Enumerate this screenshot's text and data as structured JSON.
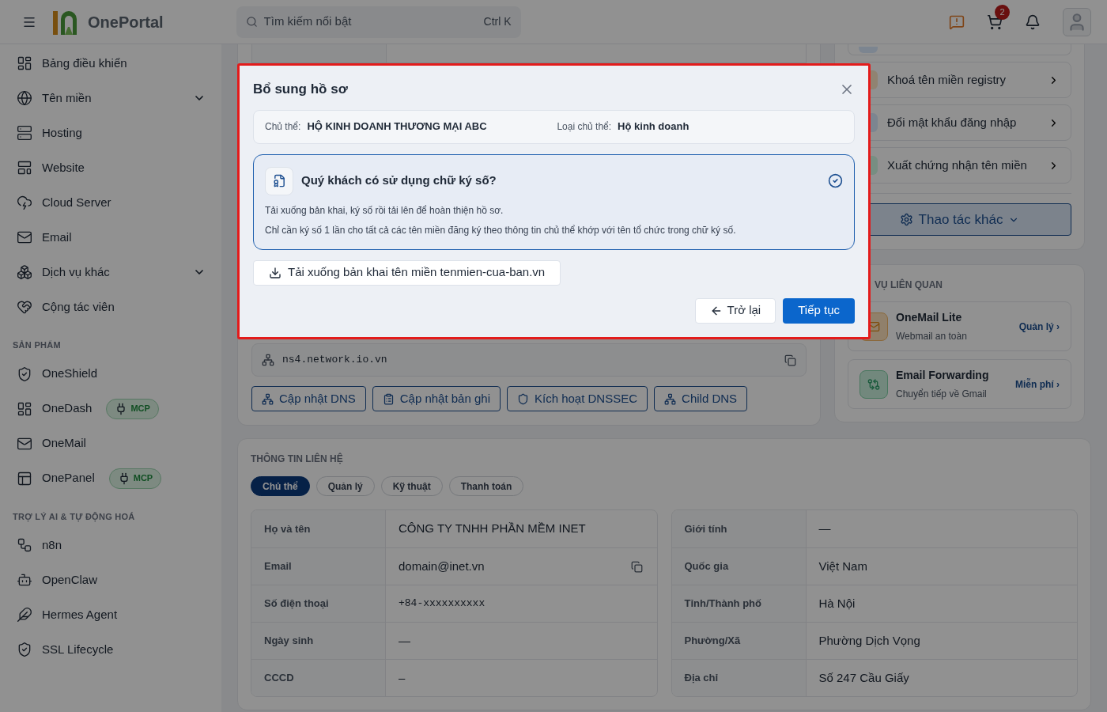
{
  "header": {
    "brand": "OnePortal",
    "search": {
      "placeholder": "Tìm kiếm nổi bật",
      "shortcut": "Ctrl K"
    },
    "cart_badge": "2"
  },
  "sidebar": {
    "sections": [
      {
        "items": [
          {
            "label": "Bảng điều khiển",
            "kind": "link"
          },
          {
            "label": "Tên miền",
            "kind": "group",
            "expanded": false
          },
          {
            "label": "Hosting",
            "kind": "link"
          },
          {
            "label": "Website",
            "kind": "link"
          },
          {
            "label": "Cloud Server",
            "kind": "link"
          },
          {
            "label": "Email",
            "kind": "link"
          },
          {
            "label": "Dịch vụ khác",
            "kind": "group",
            "expanded": false
          },
          {
            "label": "Cộng tác viên",
            "kind": "link"
          }
        ]
      },
      {
        "title": "SẢN PHẨM",
        "items": [
          {
            "label": "OneShield",
            "kind": "link"
          },
          {
            "label": "OneDash",
            "kind": "link",
            "badge": "MCP"
          },
          {
            "label": "OneMail",
            "kind": "link"
          },
          {
            "label": "OnePanel",
            "kind": "link",
            "badge": "MCP"
          }
        ]
      },
      {
        "title": "TRỢ LÝ AI & TỰ ĐỘNG HOÁ",
        "items": [
          {
            "label": "n8n",
            "kind": "link"
          },
          {
            "label": "OpenClaw",
            "kind": "link"
          },
          {
            "label": "Hermes Agent",
            "kind": "link"
          },
          {
            "label": "SSL Lifecycle",
            "kind": "link"
          }
        ]
      }
    ]
  },
  "dns": {
    "nameserver": "ns4.network.io.vn",
    "buttons": [
      "Cập nhật DNS",
      "Cập nhật bản ghi",
      "Kích hoạt DNSSEC",
      "Child DNS"
    ]
  },
  "actions": {
    "items": [
      "Khoá tên miền registry",
      "Đổi mật khẩu đăng nhập",
      "Xuất chứng nhận tên miền"
    ],
    "more": "Thao tác khác"
  },
  "related": {
    "title": "VỤ LIÊN QUAN",
    "services": [
      {
        "name": "OneMail Lite",
        "subtitle": "Webmail an toàn",
        "link": "Quản lý ›"
      },
      {
        "name": "Email Forwarding",
        "subtitle": "Chuyển tiếp về Gmail",
        "link": "Miễn phí ›"
      }
    ]
  },
  "contact": {
    "title": "THÔNG TIN LIÊN HỆ",
    "tabs": [
      {
        "label": "Chủ thể",
        "selected": true
      },
      {
        "label": "Quản lý",
        "selected": false
      },
      {
        "label": "Kỹ thuật",
        "selected": false
      },
      {
        "label": "Thanh toán",
        "selected": false
      }
    ],
    "left_rows": [
      {
        "label": "Họ và tên",
        "value": "CÔNG TY TNHH PHẦN MỀM INET",
        "copyable": false
      },
      {
        "label": "Email",
        "value": "domain@inet.vn",
        "copyable": true
      },
      {
        "label": "Số điện thoại",
        "value": "+84-xxxxxxxxxx",
        "copyable": false
      },
      {
        "label": "Ngày sinh",
        "value": "—",
        "copyable": false
      },
      {
        "label": "CCCD",
        "value": "–",
        "copyable": false
      }
    ],
    "right_rows": [
      {
        "label": "Giới tính",
        "value": "—",
        "copyable": false
      },
      {
        "label": "Quốc gia",
        "value": "Việt Nam",
        "copyable": false
      },
      {
        "label": "Tỉnh/Thành phố",
        "value": "Hà Nội",
        "copyable": false
      },
      {
        "label": "Phường/Xã",
        "value": "Phường Dịch Vọng",
        "copyable": false
      },
      {
        "label": "Địa chỉ",
        "value": "Số 247 Cầu Giấy",
        "copyable": false
      }
    ]
  },
  "modal": {
    "title": "Bổ sung hồ sơ",
    "subject": {
      "label": "Chủ thể:",
      "value": "HỘ KINH DOANH THƯƠNG MẠI ABC"
    },
    "subject_type": {
      "label": "Loại chủ thể:",
      "value": "Hộ kinh doanh"
    },
    "option": {
      "title": "Quý khách có sử dụng chữ ký số?",
      "lines": [
        "Tải xuống bản khai, ký số rồi tải lên để hoàn thiện hồ sơ.",
        "Chỉ cần ký số 1 lần cho tất cả các tên miền đăng ký theo thông tin chủ thể khớp với tên tổ chức trong chữ ký số."
      ],
      "selected": true
    },
    "download": "Tải xuống bản khai tên miền tenmien-cua-ban.vn",
    "back": "Trở lại",
    "next": "Tiếp tục"
  }
}
